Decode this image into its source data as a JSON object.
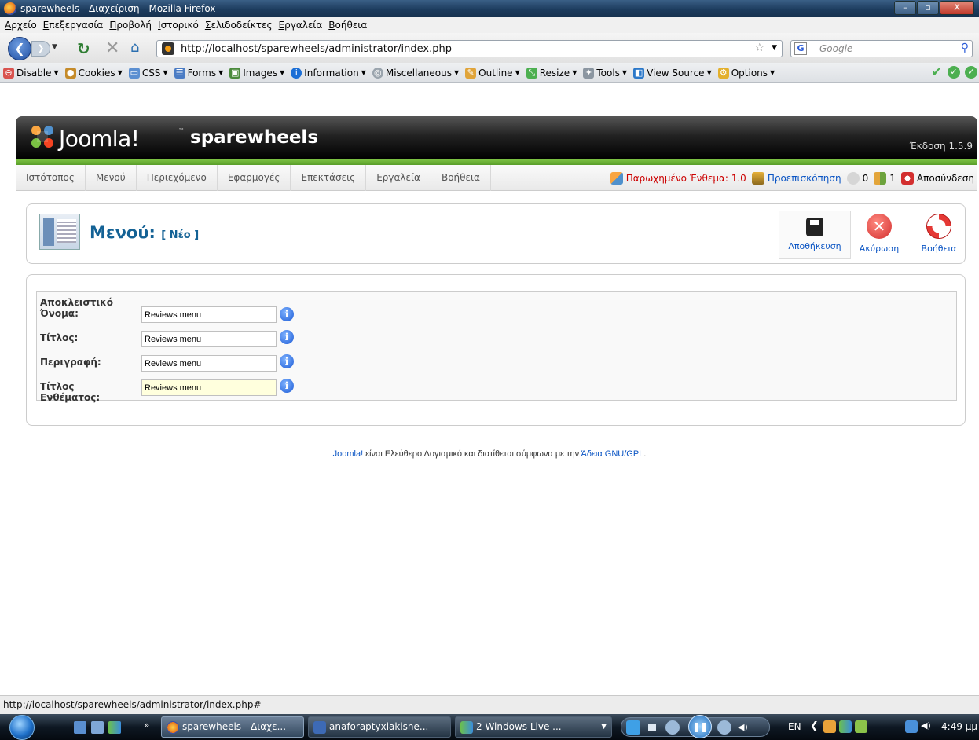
{
  "window": {
    "title": "sparewheels - Διαχείριση - Mozilla Firefox",
    "buttons": [
      "–",
      "▫",
      "X"
    ]
  },
  "menubar": [
    "Αρχείο",
    "Επεξεργασία",
    "Προβολή",
    "Ιστορικό",
    "Σελιδοδείκτες",
    "Εργαλεία",
    "Βοήθεια"
  ],
  "navbar": {
    "url": "http://localhost/sparewheels/administrator/index.php",
    "search_placeholder": "Google"
  },
  "devtoolbar": {
    "items": [
      {
        "label": "Disable",
        "icon": "disable-icon",
        "color": "#d9534f"
      },
      {
        "label": "Cookies",
        "icon": "cookies-icon",
        "color": "#c58b2a"
      },
      {
        "label": "CSS",
        "icon": "css-icon",
        "color": "#5b8fd1"
      },
      {
        "label": "Forms",
        "icon": "forms-icon",
        "color": "#4b7cc4"
      },
      {
        "label": "Images",
        "icon": "images-icon",
        "color": "#4b8a3c"
      },
      {
        "label": "Information",
        "icon": "information-icon",
        "color": "#1c6fd6"
      },
      {
        "label": "Miscellaneous",
        "icon": "miscellaneous-icon",
        "color": "#9aa4ad"
      },
      {
        "label": "Outline",
        "icon": "outline-icon",
        "color": "#e0a43a"
      },
      {
        "label": "Resize",
        "icon": "resize-icon",
        "color": "#4caf50"
      },
      {
        "label": "Tools",
        "icon": "tools-icon",
        "color": "#8b96a1"
      },
      {
        "label": "View Source",
        "icon": "view-source-icon",
        "color": "#2b78c9"
      },
      {
        "label": "Options",
        "icon": "options-icon",
        "color": "#e3b02d"
      }
    ]
  },
  "joomla": {
    "logo_text": "Joomla!",
    "site_name": "sparewheels",
    "version": "Έκδοση 1.5.9",
    "menu": [
      "Ιστότοπος",
      "Μενού",
      "Περιεχόμενο",
      "Εφαρμογές",
      "Επεκτάσεις",
      "Εργαλεία",
      "Βοήθεια"
    ],
    "status": {
      "legacy": "Παρωχημένο Ένθεμα: 1.0",
      "preview": "Προεπισκόπηση",
      "messages": "0",
      "users": "1",
      "logout": "Αποσύνδεση"
    },
    "page_title": "Μενού:",
    "page_subtitle": "[ Νέο ]",
    "toolbar": {
      "save": "Αποθήκευση",
      "cancel": "Ακύρωση",
      "help": "Βοήθεια"
    },
    "form": [
      {
        "label": "Αποκλειστικό Όνομα:",
        "value": "Reviews menu"
      },
      {
        "label": "Τίτλος:",
        "value": "Reviews menu"
      },
      {
        "label": "Περιγραφή:",
        "value": "Reviews menu"
      },
      {
        "label": "Τίτλος Ενθέματος:",
        "value": "Reviews menu"
      }
    ],
    "footer": {
      "brand": "Joomla!",
      "text": " είναι Ελεύθερο Λογισμικό και διατίθεται σύμφωνα με την ",
      "license": "Άδεια GNU/GPL",
      "end": "."
    }
  },
  "statusbar": "http://localhost/sparewheels/administrator/index.php#",
  "taskbar": {
    "tasks": [
      {
        "label": "sparewheels - Διαχε..."
      },
      {
        "label": "anaforaptyxiakisne..."
      },
      {
        "label": "2 Windows Live ..."
      }
    ],
    "language": "EN",
    "time": "4:49 μμ"
  }
}
